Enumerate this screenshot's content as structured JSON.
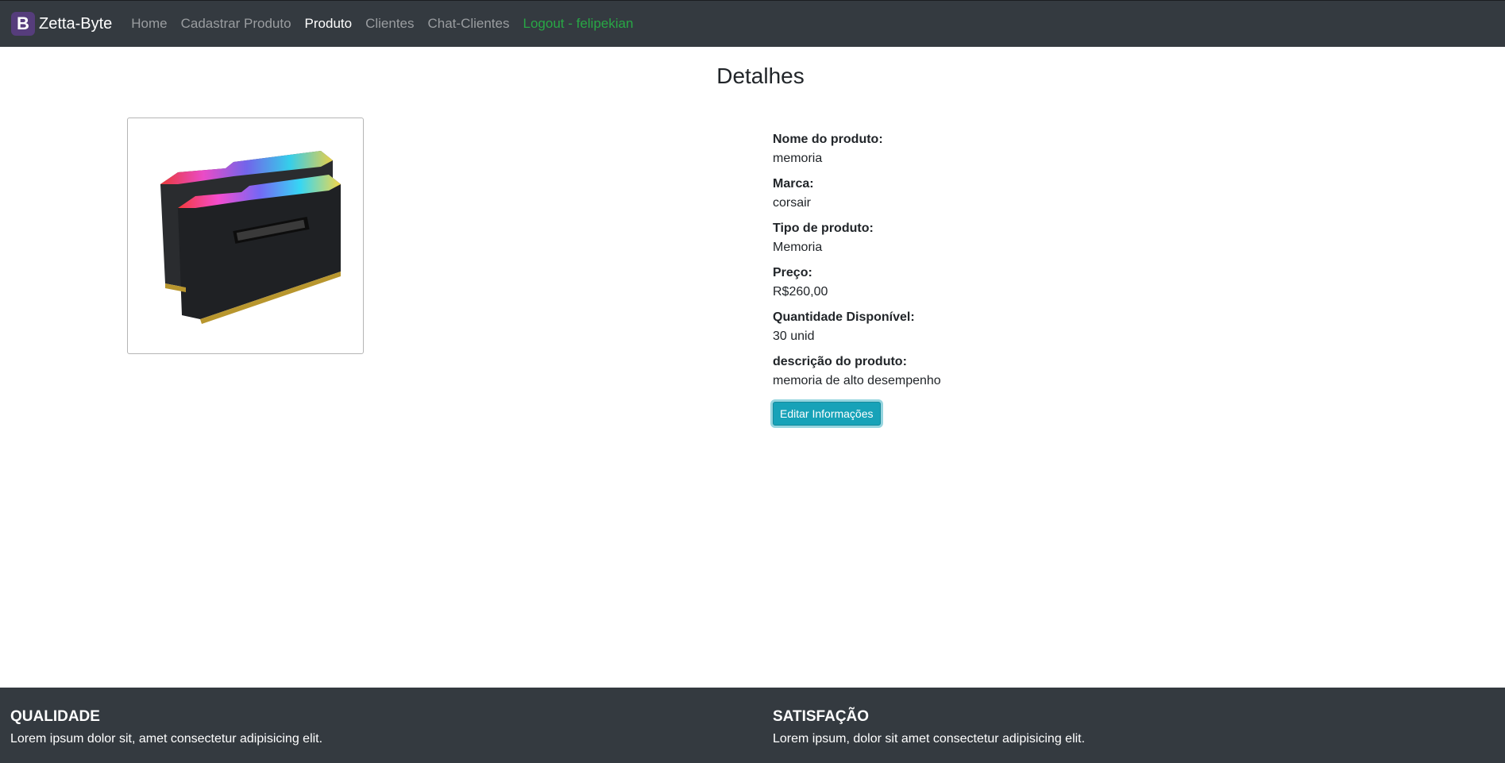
{
  "navbar": {
    "brand_logo": "B",
    "brand_name": "Zetta-Byte",
    "links": [
      {
        "label": "Home"
      },
      {
        "label": "Cadastrar Produto"
      },
      {
        "label": "Produto"
      },
      {
        "label": "Clientes"
      },
      {
        "label": "Chat-Clientes"
      },
      {
        "label": "Logout - felipekian"
      }
    ],
    "active_link": "Produto"
  },
  "page": {
    "title": "Detalhes"
  },
  "product": {
    "image_name": "ram-memory-image",
    "fields": [
      {
        "label": "Nome do produto:",
        "value": "memoria"
      },
      {
        "label": "Marca:",
        "value": "corsair"
      },
      {
        "label": "Tipo de produto:",
        "value": "Memoria"
      },
      {
        "label": "Preço:",
        "value": "R$260,00"
      },
      {
        "label": "Quantidade Disponível:",
        "value": "30 unid"
      },
      {
        "label": "descrição do produto:",
        "value": "memoria de alto desempenho"
      }
    ],
    "edit_button_label": "Editar Informações"
  },
  "footer": {
    "left": {
      "title": "QUALIDADE",
      "text": "Lorem ipsum dolor sit, amet consectetur adipisicing elit."
    },
    "right": {
      "title": "SATISFAÇÃO",
      "text": "Lorem ipsum, dolor sit amet consectetur adipisicing elit."
    }
  },
  "colors": {
    "navbar_bg": "#343a40",
    "brand_logo_bg": "#563d7c",
    "logout_link": "#28a745",
    "edit_button": "#17a2b8"
  }
}
